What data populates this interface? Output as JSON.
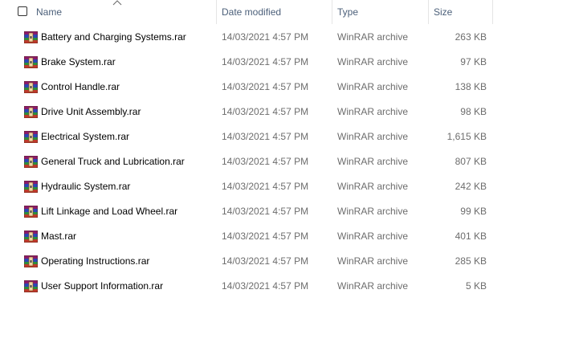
{
  "header": {
    "name": "Name",
    "date_modified": "Date modified",
    "type": "Type",
    "size": "Size"
  },
  "files": [
    {
      "name": "Battery and Charging Systems.rar",
      "date": "14/03/2021 4:57 PM",
      "type": "WinRAR archive",
      "size": "263 KB"
    },
    {
      "name": "Brake System.rar",
      "date": "14/03/2021 4:57 PM",
      "type": "WinRAR archive",
      "size": "97 KB"
    },
    {
      "name": "Control Handle.rar",
      "date": "14/03/2021 4:57 PM",
      "type": "WinRAR archive",
      "size": "138 KB"
    },
    {
      "name": "Drive Unit Assembly.rar",
      "date": "14/03/2021 4:57 PM",
      "type": "WinRAR archive",
      "size": "98 KB"
    },
    {
      "name": "Electrical System.rar",
      "date": "14/03/2021 4:57 PM",
      "type": "WinRAR archive",
      "size": "1,615 KB"
    },
    {
      "name": "General Truck and Lubrication.rar",
      "date": "14/03/2021 4:57 PM",
      "type": "WinRAR archive",
      "size": "807 KB"
    },
    {
      "name": "Hydraulic System.rar",
      "date": "14/03/2021 4:57 PM",
      "type": "WinRAR archive",
      "size": "242 KB"
    },
    {
      "name": "Lift Linkage and Load Wheel.rar",
      "date": "14/03/2021 4:57 PM",
      "type": "WinRAR archive",
      "size": "99 KB"
    },
    {
      "name": "Mast.rar",
      "date": "14/03/2021 4:57 PM",
      "type": "WinRAR archive",
      "size": "401 KB"
    },
    {
      "name": "Operating Instructions.rar",
      "date": "14/03/2021 4:57 PM",
      "type": "WinRAR archive",
      "size": "285 KB"
    },
    {
      "name": "User Support Information.rar",
      "date": "14/03/2021 4:57 PM",
      "type": "WinRAR archive",
      "size": "5 KB"
    }
  ],
  "icons": {
    "file_icon": "winrar-archive-icon",
    "sort_indicator": "sort-ascending-chevron-icon"
  },
  "colors": {
    "header_text": "#4c607a",
    "secondary_text": "#6d6d6d",
    "column_separator": "#e5e5e5"
  }
}
